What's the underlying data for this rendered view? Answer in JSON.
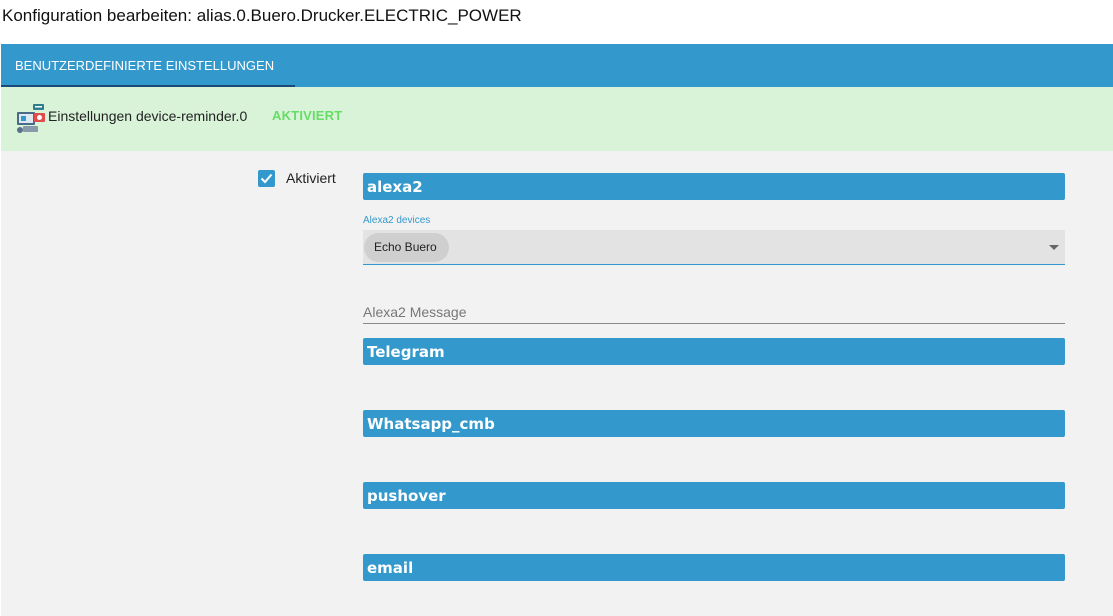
{
  "page": {
    "title": "Konfiguration bearbeiten: alias.0.Buero.Drucker.ELECTRIC_POWER"
  },
  "tabs": [
    {
      "label": "BENUTZERDEFINIERTE EINSTELLUNGEN",
      "active": true
    }
  ],
  "adapter": {
    "title": "Einstellungen device-reminder.0",
    "status": "AKTIVIERT",
    "icon": "device-reminder-icon"
  },
  "settings": {
    "enabled_label": "Aktiviert",
    "enabled": true,
    "sections": {
      "alexa2": "alexa2",
      "telegram": "Telegram",
      "whatsapp": "Whatsapp_cmb",
      "pushover": "pushover",
      "email": "email"
    },
    "alexa2_devices": {
      "label": "Alexa2 devices",
      "selected": "Echo Buero"
    },
    "alexa2_message": {
      "placeholder": "Alexa2 Message",
      "value": ""
    }
  },
  "colors": {
    "accent": "#3399cc",
    "status_active": "#66dd66",
    "adapter_bar_bg": "#d9f3d9",
    "content_bg": "#f2f2f2"
  }
}
